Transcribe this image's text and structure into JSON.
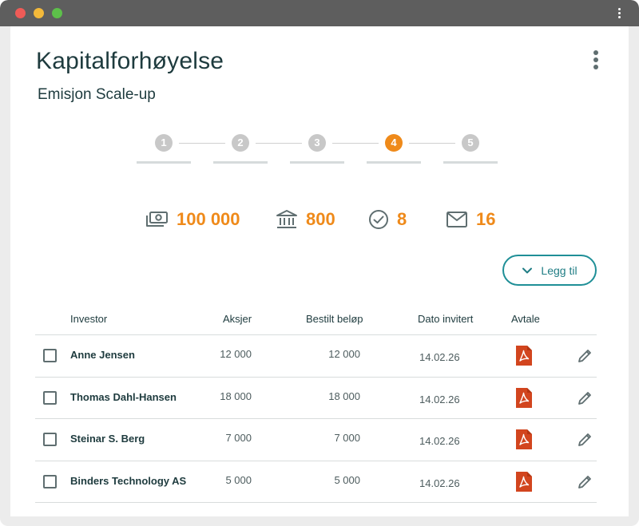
{
  "page": {
    "title": "Kapitalforhøyelse",
    "subtitle": "Emisjon Scale-up"
  },
  "stepper": {
    "steps": [
      "1",
      "2",
      "3",
      "4",
      "5"
    ],
    "active_step": "4"
  },
  "stats": {
    "amount": "100 000",
    "amount_icon": "money-icon",
    "bank": "800",
    "bank_icon": "bank-icon",
    "approved": "8",
    "approved_icon": "check-circle-icon",
    "invited": "16",
    "invited_icon": "mail-icon"
  },
  "actions": {
    "add_label": "Legg til"
  },
  "table": {
    "headers": {
      "investor": "Investor",
      "shares": "Aksjer",
      "ordered_amount": "Bestilt beløp",
      "date_invited": "Dato invitert",
      "agreement": "Avtale"
    },
    "rows": [
      {
        "investor": "Anne Jensen",
        "shares": "12 000",
        "ordered_amount": "12 000",
        "date_invited": "14.02.26"
      },
      {
        "investor": "Thomas Dahl-Hansen",
        "shares": "18 000",
        "ordered_amount": "18 000",
        "date_invited": "14.02.26"
      },
      {
        "investor": "Steinar S. Berg",
        "shares": "7 000",
        "ordered_amount": "7 000",
        "date_invited": "14.02.26"
      },
      {
        "investor": "Binders Technology AS",
        "shares": "5 000",
        "ordered_amount": "5 000",
        "date_invited": "14.02.26"
      }
    ]
  },
  "colors": {
    "accent": "#ef8a1a",
    "teal": "#1f8f97",
    "pdf_red": "#d2451e",
    "text_dark": "#1e3b3e"
  }
}
